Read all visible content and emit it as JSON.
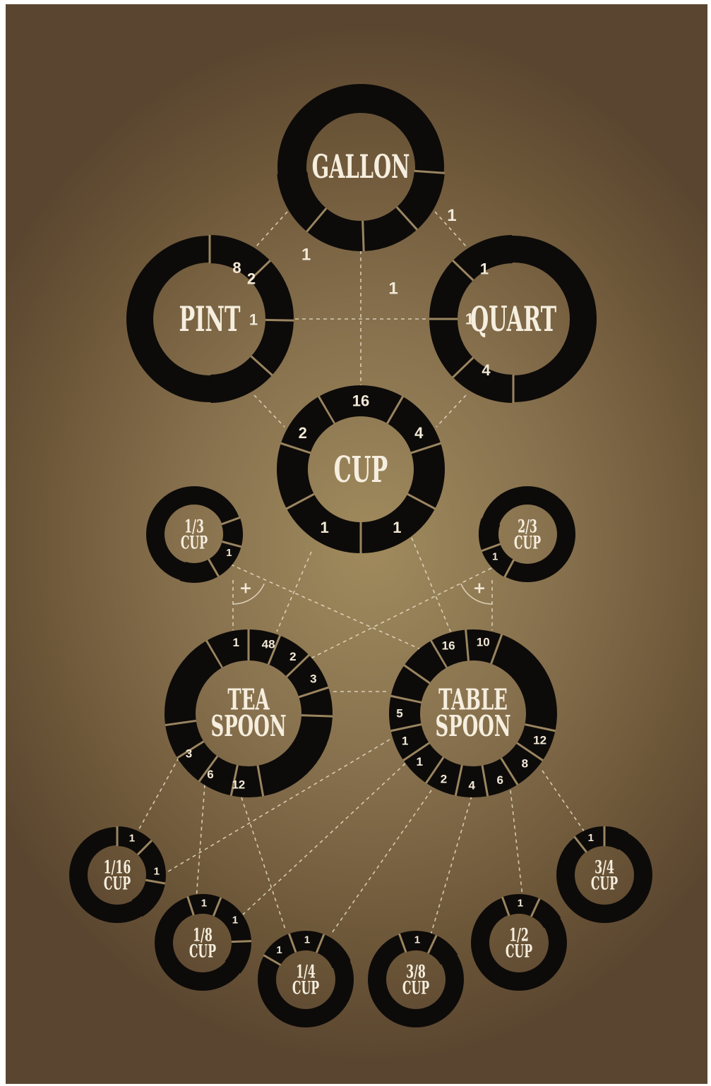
{
  "colors": {
    "ring": "#0d0b09",
    "text": "#f2e8d6",
    "link": "#e6dcc4"
  },
  "units": [
    {
      "id": "gallon",
      "name": [
        "GALLON"
      ],
      "values": [
        "1",
        "1",
        "1"
      ]
    },
    {
      "id": "pint",
      "name": [
        "PINT"
      ],
      "values": [
        "8",
        "2",
        "1"
      ]
    },
    {
      "id": "quart",
      "name": [
        "QUART"
      ],
      "values": [
        "4",
        "1",
        "1"
      ]
    },
    {
      "id": "cup",
      "name": [
        "CUP"
      ],
      "values": [
        "16",
        "4",
        "1",
        "1",
        "2"
      ]
    },
    {
      "id": "third-cup",
      "name": [
        "1/3",
        "CUP"
      ],
      "values": [
        "1"
      ]
    },
    {
      "id": "two-thirds-cup",
      "name": [
        "2/3",
        "CUP"
      ],
      "values": [
        "1"
      ]
    },
    {
      "id": "teaspoon",
      "name": [
        "TEA",
        "SPOON"
      ],
      "values": [
        "1",
        "48",
        "2",
        "3",
        "12",
        "6",
        "3"
      ]
    },
    {
      "id": "tablespoon",
      "name": [
        "TABLE",
        "SPOON"
      ],
      "values": [
        "16",
        "10",
        "12",
        "8",
        "6",
        "4",
        "2",
        "1",
        "1",
        "5"
      ]
    },
    {
      "id": "sixteenth-cup",
      "name": [
        "1/16",
        "CUP"
      ],
      "values": [
        "1",
        "1"
      ]
    },
    {
      "id": "eighth-cup",
      "name": [
        "1/8",
        "CUP"
      ],
      "values": [
        "1",
        "1"
      ]
    },
    {
      "id": "quarter-cup",
      "name": [
        "1/4",
        "CUP"
      ],
      "values": [
        "1",
        "1"
      ]
    },
    {
      "id": "three-eighths-cup",
      "name": [
        "3/8",
        "CUP"
      ],
      "values": [
        "1"
      ]
    },
    {
      "id": "half-cup",
      "name": [
        "1/2",
        "CUP"
      ],
      "values": [
        "1"
      ]
    },
    {
      "id": "three-quarters-cup",
      "name": [
        "3/4",
        "CUP"
      ],
      "values": [
        "1"
      ]
    }
  ],
  "plus_symbol": "+"
}
